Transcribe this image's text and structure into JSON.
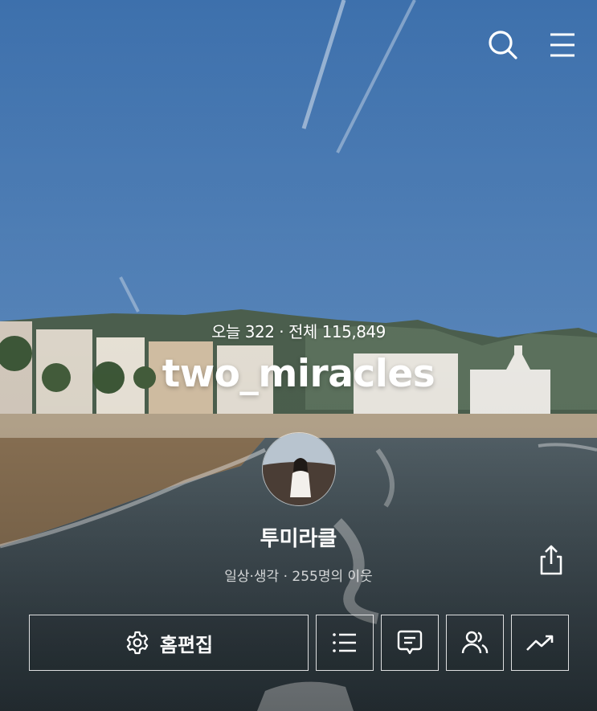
{
  "header": {
    "icons": [
      "search-icon",
      "menu-icon"
    ]
  },
  "stats": {
    "text": "오늘 322 · 전체 115,849"
  },
  "blog": {
    "title": "two_miracles"
  },
  "profile": {
    "nickname": "투미라클",
    "subline": "일상·생각 · 255명의 이웃",
    "share_icon": "share-icon"
  },
  "actions": {
    "edit_label": "홈편집",
    "edit_icon": "gear-icon",
    "icon_buttons": [
      "list-icon",
      "comment-icon",
      "neighbors-icon",
      "stats-icon"
    ]
  },
  "colors": {
    "sky_top": "#3f72ad",
    "sky_bottom": "#9bbbdb",
    "sea": "#3e4a51",
    "text": "#ffffff"
  }
}
